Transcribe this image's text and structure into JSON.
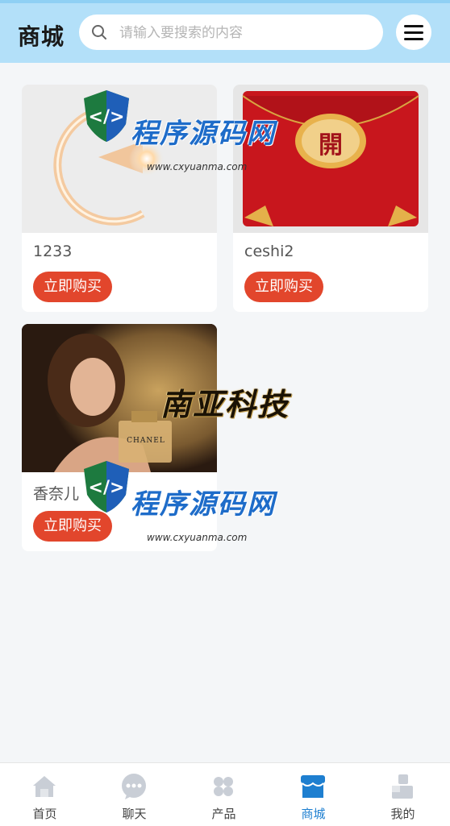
{
  "header": {
    "title": "商城",
    "search_placeholder": "请输入要搜索的内容"
  },
  "products": [
    {
      "name": "1233",
      "buy_label": "立即购买"
    },
    {
      "name": "ceshi2",
      "buy_label": "立即购买",
      "image_text": "開"
    },
    {
      "name": "香奈儿",
      "buy_label": "立即购买",
      "image_text": "CHANEL"
    }
  ],
  "watermarks": [
    {
      "text": "程序源码网",
      "url": "www.cxyuanma.com"
    },
    {
      "text": "程序源码网",
      "url": "www.cxyuanma.com"
    }
  ],
  "brand_seal": "南亚科技",
  "tabbar": {
    "items": [
      {
        "label": "首页",
        "icon": "home-icon",
        "active": false
      },
      {
        "label": "聊天",
        "icon": "chat-icon",
        "active": false
      },
      {
        "label": "产品",
        "icon": "grid-icon",
        "active": false
      },
      {
        "label": "商城",
        "icon": "store-icon",
        "active": true
      },
      {
        "label": "我的",
        "icon": "user-icon",
        "active": false
      }
    ]
  },
  "colors": {
    "header_bg": "#b3e0f9",
    "buy_button": "#e2462c",
    "active_tab": "#1e7fd0"
  }
}
